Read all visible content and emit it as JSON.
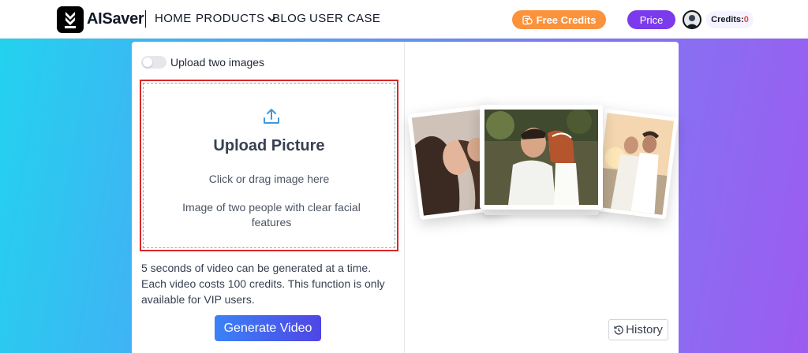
{
  "header": {
    "brand": "AISaver",
    "nav": {
      "home": "HOME",
      "products": "PRODUCTS",
      "blog": "BLOG",
      "user_case": "USER CASE"
    },
    "free_credits_label": "Free Credits",
    "price_label": "Price",
    "credits_label": "Credits:",
    "credits_value": "0"
  },
  "upload": {
    "toggle_label": "Upload two images",
    "title": "Upload Picture",
    "hint": "Click or drag image here",
    "requirement": "Image of two people with clear facial features"
  },
  "info": {
    "note": "5 seconds of video can be generated at a time. Each video costs 100 credits. This function is only available for VIP users.",
    "generate_label": "Generate Video"
  },
  "preview": {
    "history_label": "History"
  },
  "colors": {
    "accent_orange": "#fb923c",
    "accent_purple": "#7c3aed",
    "generate_blue": "#3b82f6",
    "highlight_red": "#dc2626",
    "credits_value_red": "#ef4444"
  },
  "icons": [
    "download-logo-icon",
    "chevron-down-icon",
    "coins-icon",
    "avatar",
    "upload-icon",
    "history-clock-icon"
  ]
}
